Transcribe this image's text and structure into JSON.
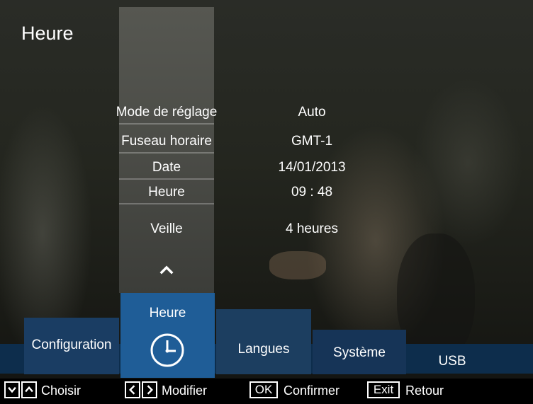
{
  "screen": {
    "title": "Heure"
  },
  "settings": [
    {
      "label": "Mode de réglage",
      "value": "Auto"
    },
    {
      "label": "Fuseau horaire",
      "value": "GMT-1"
    },
    {
      "label": "Date",
      "value": "14/01/2013"
    },
    {
      "label": "Heure",
      "value": "09 : 48"
    },
    {
      "label": "Veille",
      "value": "4 heures"
    }
  ],
  "scroll": {
    "icon": "chevron-up-icon"
  },
  "menu": {
    "tabs": [
      {
        "label": "Configuration"
      },
      {
        "label": "Heure",
        "icon": "clock-icon",
        "selected": true
      },
      {
        "label": "Langues"
      },
      {
        "label": "Système"
      },
      {
        "label": "USB"
      }
    ]
  },
  "hints": {
    "choose": "Choisir",
    "modify": "Modifier",
    "ok_key": "OK",
    "confirm": "Confirmer",
    "exit_key": "Exit",
    "back": "Retour"
  },
  "colors": {
    "menubar": "#0d2d4c",
    "selected_tab": "#1f5d97"
  }
}
